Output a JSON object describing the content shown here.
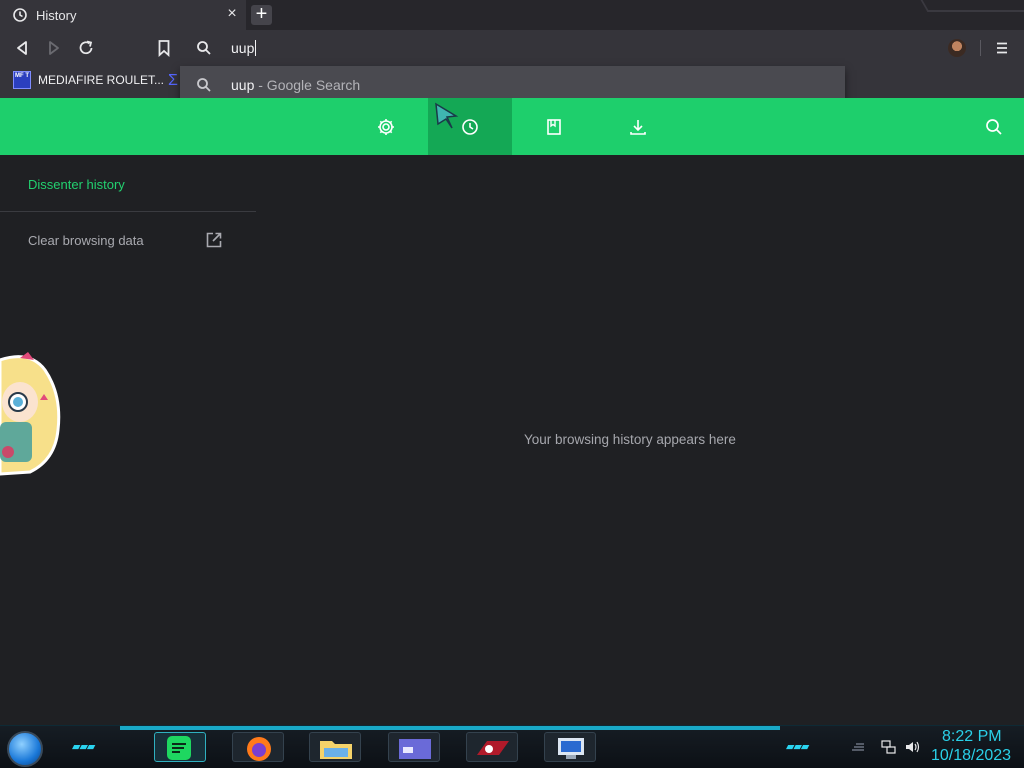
{
  "tab": {
    "title": "History",
    "close_label": "×",
    "new_tab_label": "+"
  },
  "omnibox": {
    "value": "uup"
  },
  "dropdown": {
    "query": "uup",
    "suffix": " - Google Search"
  },
  "bookmarks": [
    {
      "label": "MEDIAFIRE ROULET...",
      "favicon_text": "MF T"
    }
  ],
  "green_nav": {
    "items": [
      "settings-icon",
      "history-icon",
      "bookmarks-icon",
      "downloads-icon",
      "search-icon"
    ],
    "active": "history-icon",
    "accent": "#1ecf6c"
  },
  "sidebar": {
    "title": "Dissenter history",
    "clear_label": "Clear browsing data"
  },
  "main": {
    "empty_message": "Your browsing history appears here"
  },
  "taskbar": {
    "time": "8:22 PM",
    "date": "10/18/2023"
  }
}
